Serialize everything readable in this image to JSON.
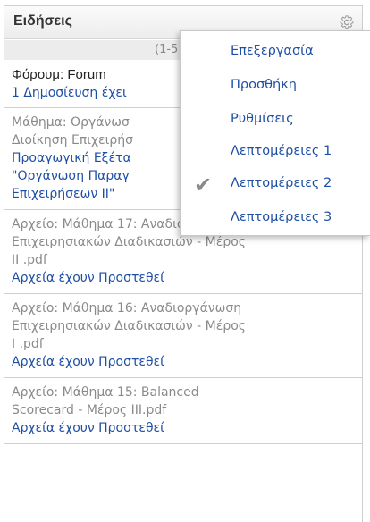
{
  "panel": {
    "title": "Ειδήσεις",
    "pager": "(1-5"
  },
  "news": [
    {
      "lines": [
        {
          "type": "dark",
          "text": "Φόρουμ: Forum"
        },
        {
          "type": "link",
          "text": "1 Δημοσίευση έχει"
        }
      ]
    },
    {
      "lines": [
        {
          "type": "gray",
          "text": "Μάθημα: Οργάνωσ"
        },
        {
          "type": "gray",
          "text": "Διοίκηση Επιχειρήσ"
        },
        {
          "type": "link",
          "text": "Προαγωγική Εξέτα"
        },
        {
          "type": "link",
          "text": "\"Οργάνωση Παραγ"
        },
        {
          "type": "link",
          "text": "Επιχειρήσεων ΙΙ\""
        }
      ]
    },
    {
      "lines": [
        {
          "type": "gray",
          "text": "Αρχείο: Μάθημα 17: Αναδιοργάνωση"
        },
        {
          "type": "gray",
          "text": "Επιχειρησιακών Διαδικασιών - Μέρος"
        },
        {
          "type": "gray",
          "text": "II .pdf"
        },
        {
          "type": "link",
          "text": "Αρχεία έχουν Προστεθεί"
        }
      ]
    },
    {
      "lines": [
        {
          "type": "gray",
          "text": "Αρχείο: Μάθημα 16: Αναδιοργάνωση"
        },
        {
          "type": "gray",
          "text": "Επιχειρησιακών Διαδικασιών - Μέρος"
        },
        {
          "type": "gray",
          "text": "I .pdf"
        },
        {
          "type": "link",
          "text": "Αρχεία έχουν Προστεθεί"
        }
      ]
    },
    {
      "lines": [
        {
          "type": "gray",
          "text": "Αρχείο: Μάθημα 15: Balanced"
        },
        {
          "type": "gray",
          "text": "Scorecard - Μέρος III.pdf"
        },
        {
          "type": "link",
          "text": "Αρχεία έχουν Προστεθεί"
        }
      ]
    }
  ],
  "menu": {
    "items": [
      {
        "label": "Επεξεργασία",
        "checked": false
      },
      {
        "label": "Προσθήκη",
        "checked": false
      },
      {
        "label": "Ρυθμίσεις",
        "checked": false
      },
      {
        "label": "Λεπτομέρειες 1",
        "checked": false
      },
      {
        "label": "Λεπτομέρειες 2",
        "checked": true
      },
      {
        "label": "Λεπτομέρειες 3",
        "checked": false
      }
    ]
  },
  "icons": {
    "gear": "gear-icon",
    "check": "checkmark-icon"
  },
  "colors": {
    "link": "#1f4fa5",
    "gray_text": "#8a8a8a",
    "header_bg": "#ececec"
  }
}
